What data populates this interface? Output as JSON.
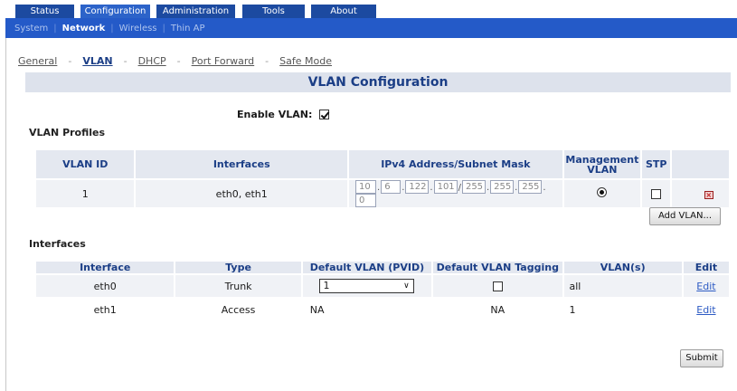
{
  "top_nav": [
    "Status",
    "Configuration",
    "Administration",
    "Tools",
    "About"
  ],
  "sub_nav": [
    "System",
    "Network",
    "Wireless",
    "Thin AP"
  ],
  "breadcrumbs": [
    "General",
    "VLAN",
    "DHCP",
    "Port Forward",
    "Safe Mode"
  ],
  "page_title": "VLAN Configuration",
  "enable_vlan": {
    "label": "Enable VLAN:",
    "checked": true
  },
  "profiles": {
    "title": "VLAN Profiles",
    "headers": {
      "vlan_id": "VLAN ID",
      "interfaces": "Interfaces",
      "ipv4": "IPv4 Address/Subnet Mask",
      "mgmt_line1": "Management",
      "mgmt_line2": "VLAN",
      "stp": "STP"
    },
    "rows": [
      {
        "vlan_id": "1",
        "interfaces": "eth0, eth1",
        "ip": [
          "10",
          "6",
          "122",
          "101"
        ],
        "mask": [
          "255",
          "255",
          "255",
          "0"
        ],
        "management": true,
        "stp": false
      }
    ],
    "add_button": "Add VLAN..."
  },
  "interfaces": {
    "title": "Interfaces",
    "headers": {
      "interface": "Interface",
      "type": "Type",
      "pvid": "Default VLAN (PVID)",
      "tagging": "Default VLAN Tagging",
      "vlans": "VLAN(s)",
      "edit": "Edit"
    },
    "rows": [
      {
        "interface": "eth0",
        "type": "Trunk",
        "pvid": "1",
        "tagging": "",
        "vlans": "all",
        "edit": "Edit"
      },
      {
        "interface": "eth1",
        "type": "Access",
        "pvid": "NA",
        "tagging": "NA",
        "vlans": "1",
        "edit": "Edit"
      }
    ]
  },
  "submit": "Submit"
}
